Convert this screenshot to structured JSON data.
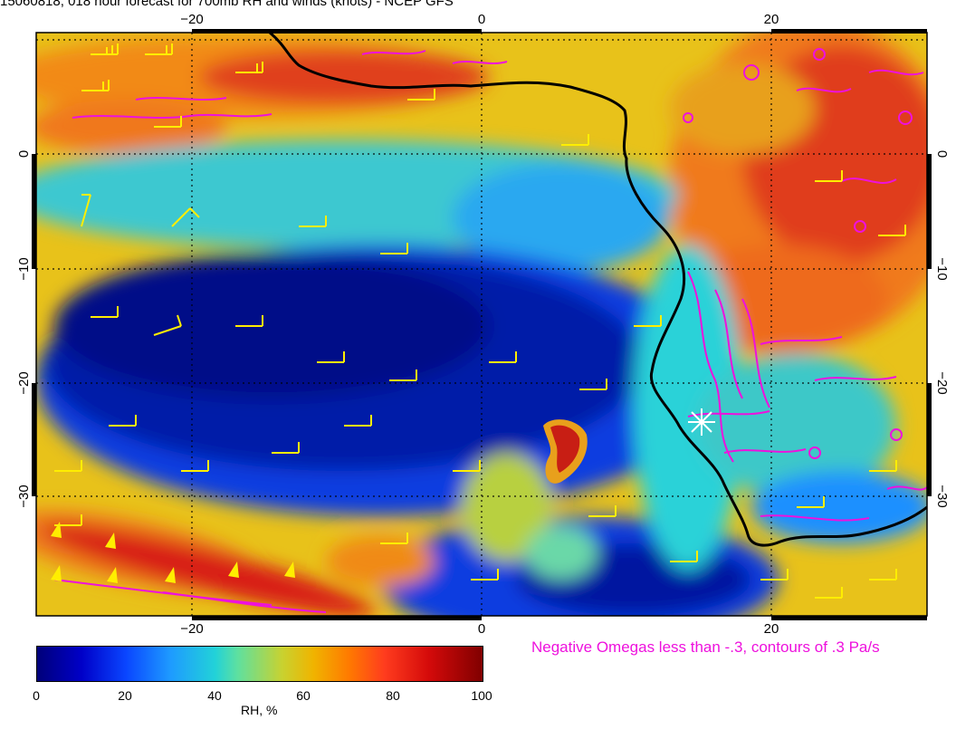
{
  "title": "15060818, 018 hour forecast for 700mb RH and winds (knots) - NCEP GFS",
  "axes": {
    "top_lon_labels": [
      "−20",
      "0",
      "20"
    ],
    "bottom_lon_labels": [
      "−20",
      "0",
      "20"
    ],
    "left_lat_labels": [
      "0",
      "−10",
      "−20",
      "−30"
    ],
    "right_lat_labels": [
      "0",
      "−10",
      "−20",
      "−30"
    ]
  },
  "note": "Negative Omegas less than -.3, contours of .3 Pa/s",
  "colorbar": {
    "ticks": [
      "0",
      "20",
      "40",
      "60",
      "80",
      "100"
    ],
    "label": "RH, %"
  },
  "colors": {
    "omega_contour": "#ee11dd",
    "wind_barb": "#ffee00",
    "coastline": "#000000",
    "marker": "#ffffff"
  }
}
